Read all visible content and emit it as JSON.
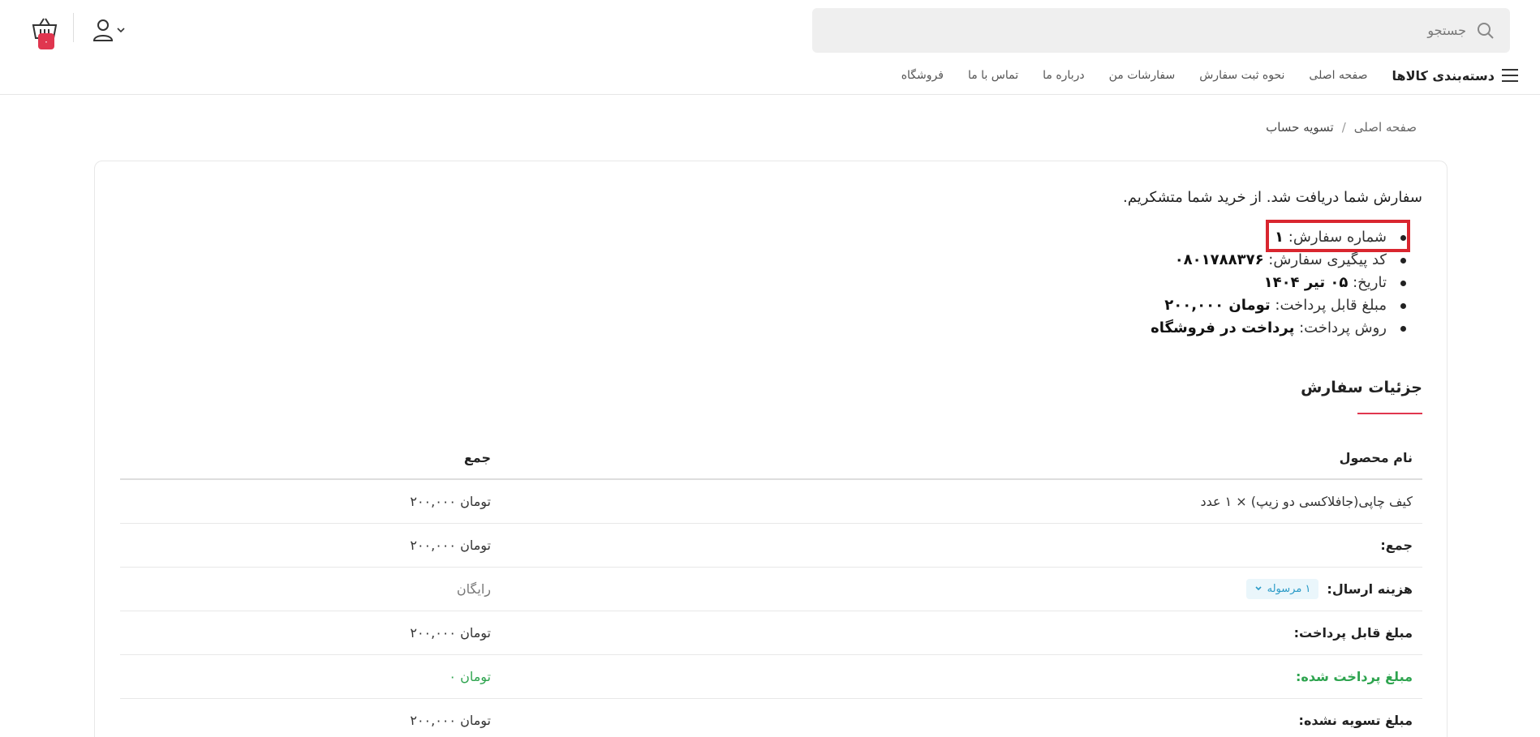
{
  "header": {
    "search_placeholder": "جستجو",
    "cart_count": "۰",
    "icons": {
      "search": "search-icon",
      "cart": "basket-icon",
      "user": "user-icon",
      "user_menu": "chevron-down-icon",
      "menu": "hamburger-icon"
    },
    "colors": {
      "accent": "#e0364f"
    }
  },
  "nav": {
    "categories_label": "دسته‌بندی کالاها",
    "items": [
      "صفحه اصلی",
      "نحوه ثبت سفارش",
      "سفارشات من",
      "درباره ما",
      "تماس با ما",
      "فروشگاه"
    ]
  },
  "breadcrumb": {
    "home": "صفحه اصلی",
    "separator": "/",
    "current": "تسویه حساب"
  },
  "order": {
    "thanks_message": "سفارش شما دریافت شد. از خرید شما متشکریم.",
    "overview": [
      {
        "label": "شماره سفارش:",
        "value": "۱"
      },
      {
        "label": "کد پیگیری سفارش:",
        "value": "۰۸۰۱۷۸۸۳۷۶"
      },
      {
        "label": "تاریخ:",
        "value": "۰۵ تیر ۱۴۰۴"
      },
      {
        "label": "مبلغ قابل پرداخت:",
        "value": "تومان ۲۰۰,۰۰۰"
      },
      {
        "label": "روش پرداخت:",
        "value": "پرداخت در فروشگاه"
      }
    ],
    "details_title": "جزئیات سفارش",
    "table": {
      "headers": {
        "product": "نام محصول",
        "total": "جمع"
      },
      "items": [
        {
          "name": "کیف چاپی(جافلاکسی دو زیپ) × ۱ عدد",
          "total": "تومان ۲۰۰,۰۰۰"
        }
      ],
      "subtotal_label": "جمع:",
      "subtotal_value": "تومان ۲۰۰,۰۰۰",
      "shipping_label": "هزینه ارسال:",
      "shipping_pill": "۱ مرسوله",
      "shipping_value": "رایگان",
      "payable_label": "مبلغ قابل پرداخت:",
      "payable_value": "تومان ۲۰۰,۰۰۰",
      "paid_label": "مبلغ پرداخت شده:",
      "paid_value": "تومان ۰",
      "unpaid_label": "مبلغ تسویه نشده:",
      "unpaid_value": "تومان ۲۰۰,۰۰۰"
    },
    "colors": {
      "paid": "#2ea44f",
      "shipping_pill": "#2b9bc7",
      "highlight": "#d9262f"
    }
  }
}
